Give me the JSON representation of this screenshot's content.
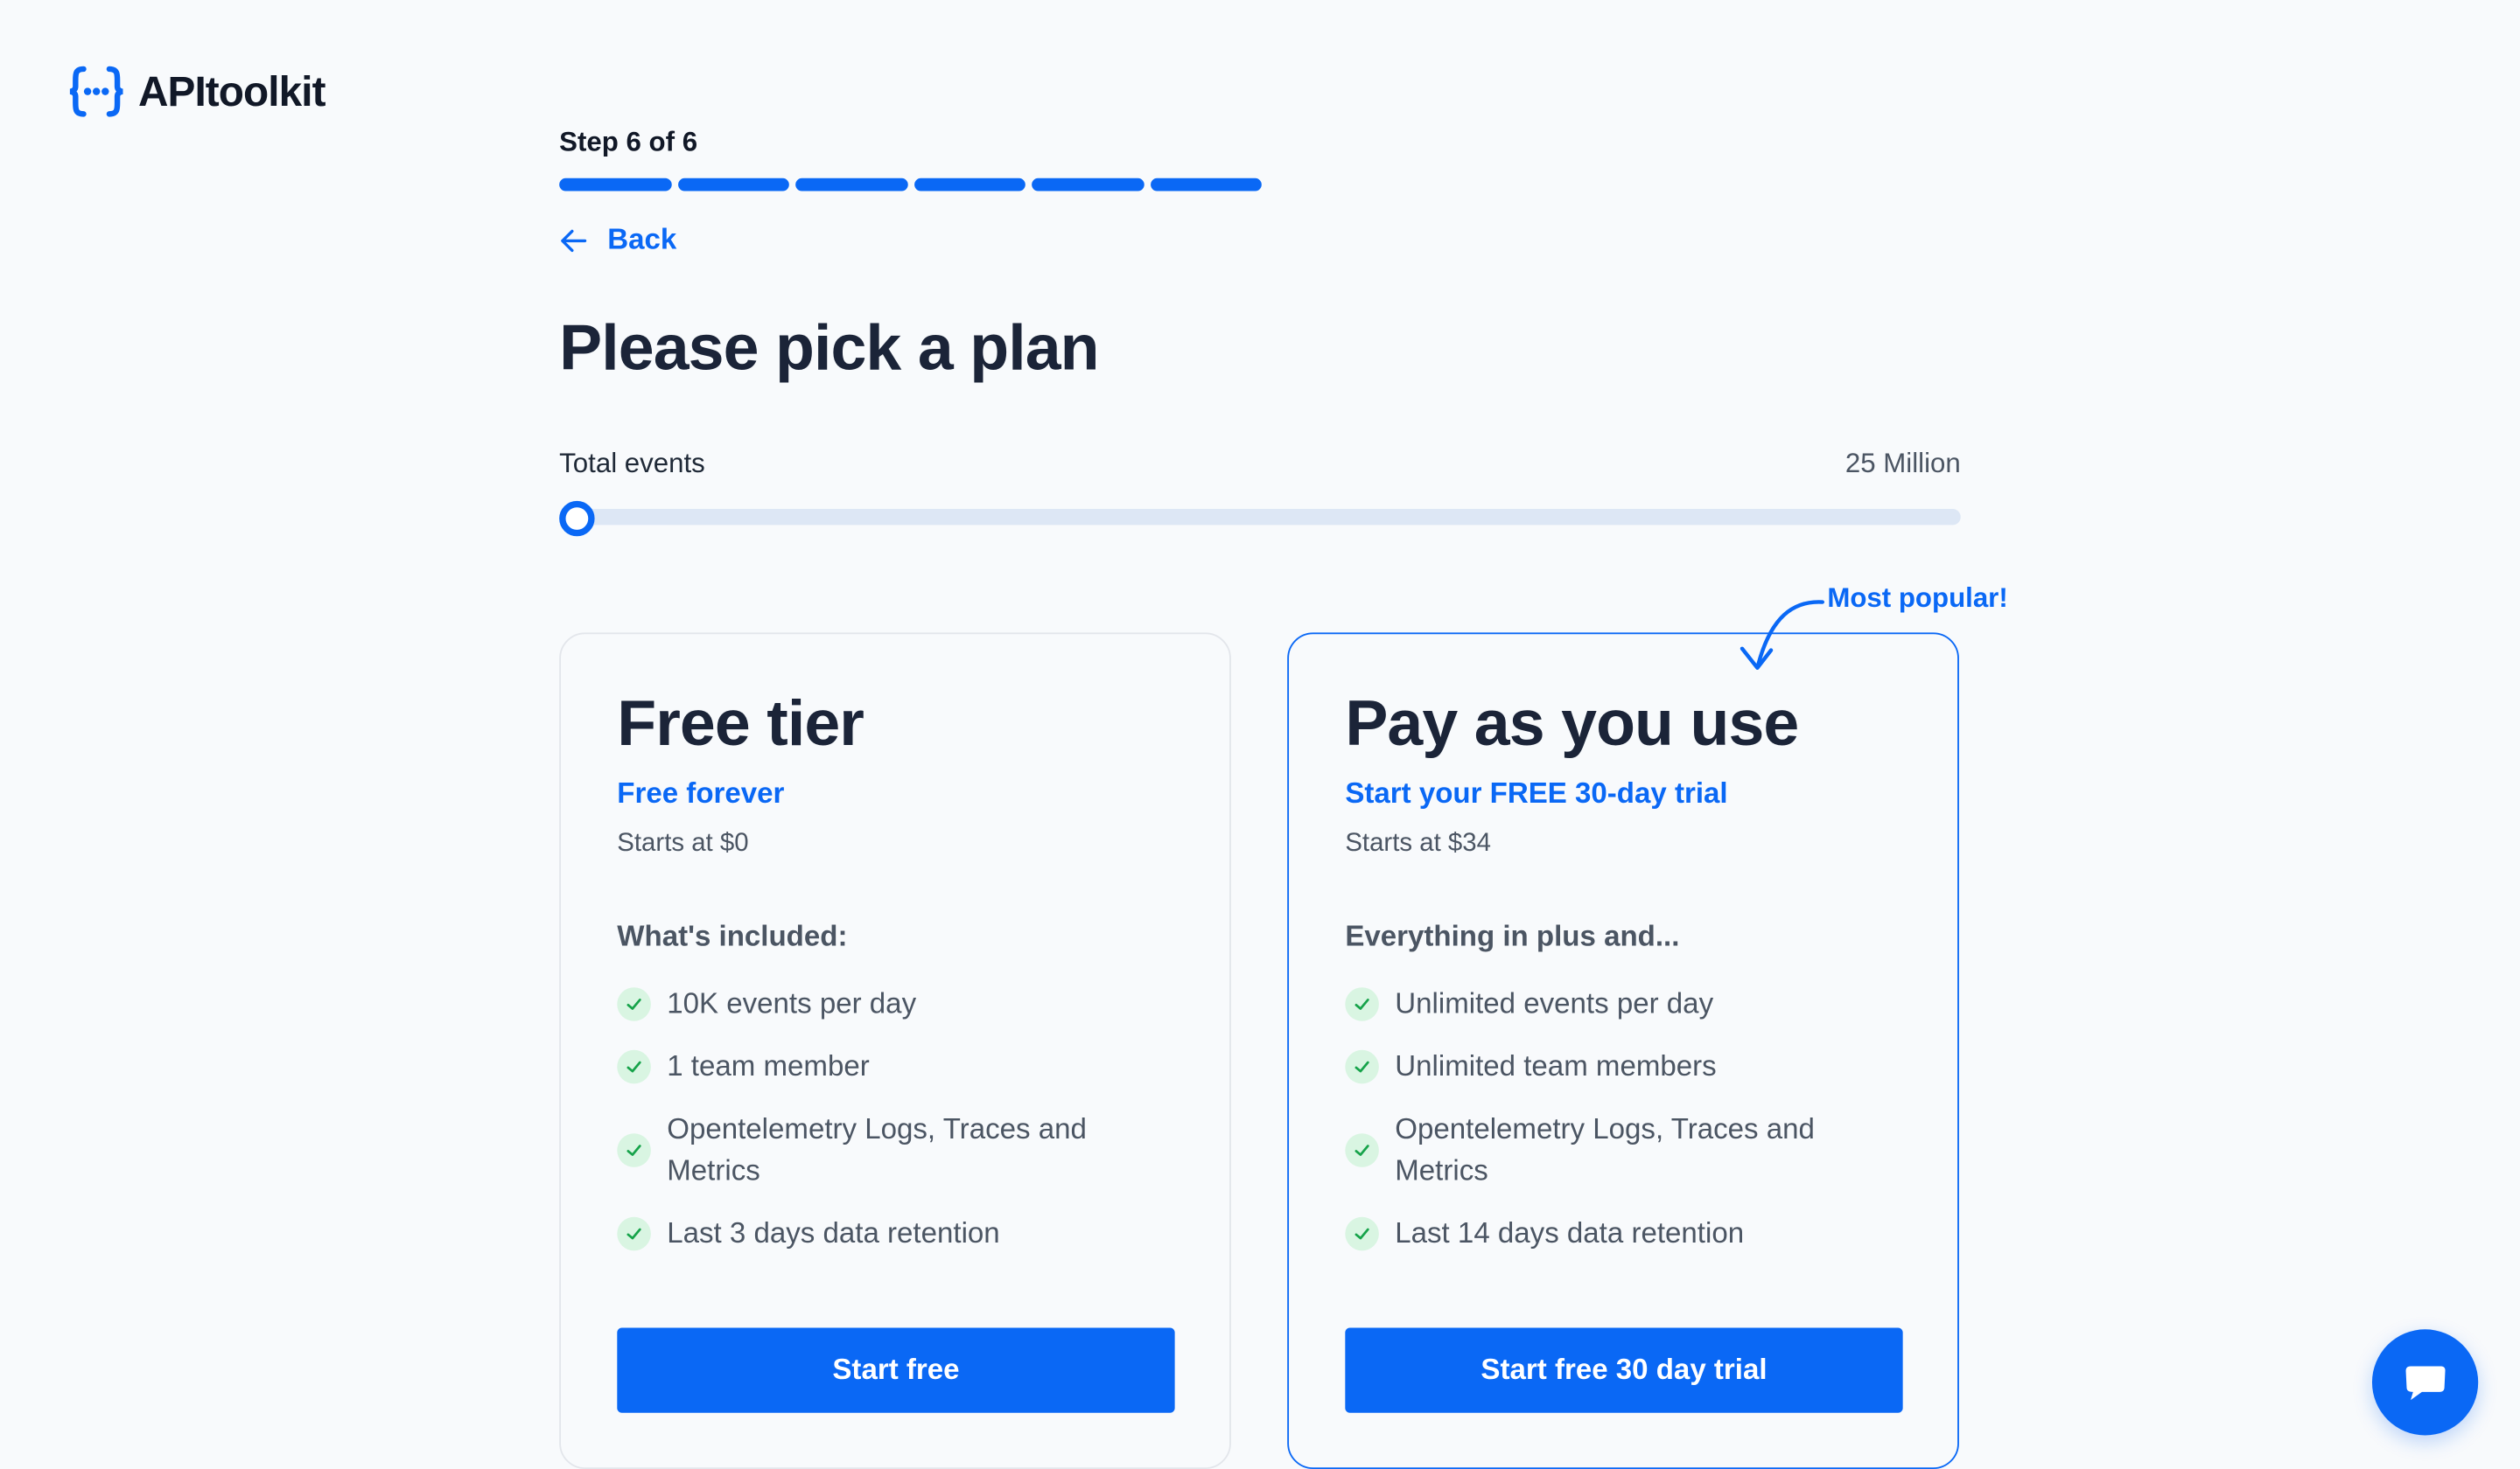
{
  "brand": {
    "name": "APItoolkit",
    "logo_icon": "curly-braces-dots-icon",
    "accent": "#0a68f5"
  },
  "wizard": {
    "step_label": "Step 6 of 6",
    "current_step": 6,
    "total_steps": 6,
    "back_label": "Back",
    "title": "Please pick a plan"
  },
  "events": {
    "label": "Total events",
    "value": "25 Million",
    "slider_level": 0
  },
  "plans": [
    {
      "name": "Free tier",
      "subtitle": "Free forever",
      "price": "Starts at $0",
      "included_heading": "What's included:",
      "features": [
        "10K events per day",
        "1 team member",
        "Opentelemetry Logs, Traces and Metrics",
        "Last 3 days data retention"
      ],
      "cta": "Start free"
    },
    {
      "name": "Pay as you use",
      "subtitle": "Start your FREE 30-day trial",
      "price": "Starts at $34",
      "included_heading": "Everything in plus and...",
      "features": [
        "Unlimited events per day",
        "Unlimited team members",
        "Opentelemetry Logs, Traces and Metrics",
        "Last 14 days data retention"
      ],
      "cta": "Start free 30 day trial",
      "badge": "Most popular!"
    }
  ],
  "chat": {
    "icon": "chat-bubble-icon"
  }
}
